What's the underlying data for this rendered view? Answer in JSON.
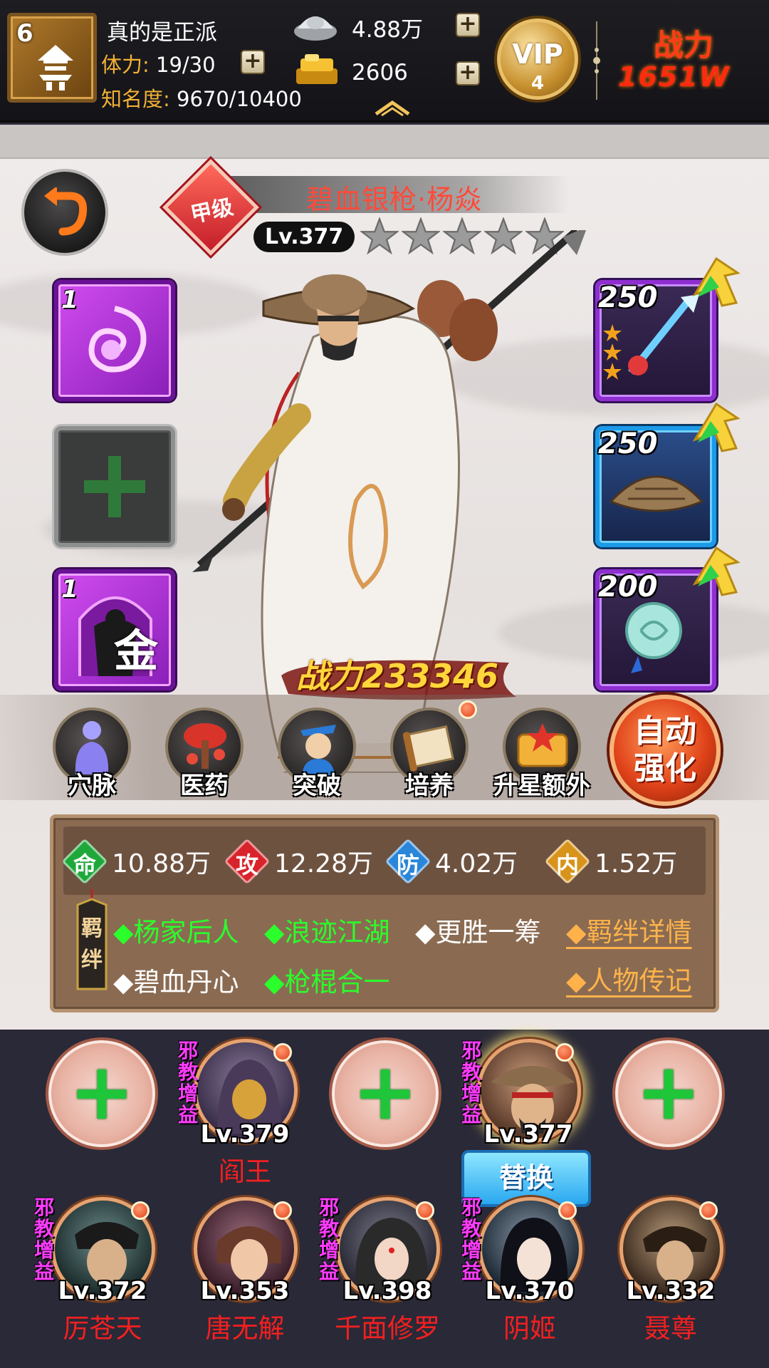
{
  "top": {
    "player_level": "6",
    "player_name": "真的是正派",
    "stamina_label": "体力:",
    "stamina_value": "19/30",
    "fame_label": "知名度:",
    "fame_value": "9670/10400",
    "silver": "4.88万",
    "gold": "2606",
    "vip_label": "VIP",
    "vip_level": "4",
    "power_label": "战力",
    "power_value": "1651W"
  },
  "hero": {
    "grade": "甲级",
    "name": "碧血银枪·杨焱",
    "level": "Lv.377",
    "stars": 5,
    "combat_power": "战力233346",
    "skill_slots": [
      {
        "count": "1",
        "icon": "purple-swirl-skill-icon"
      },
      {
        "count": "",
        "icon": "add-skill-icon"
      },
      {
        "count": "1",
        "icon": "purple-gold-skill-icon",
        "glyph": "金"
      }
    ],
    "equip_slots": [
      {
        "level": "250",
        "icon": "spear-weapon-icon"
      },
      {
        "level": "250",
        "icon": "straw-hat-armor-icon"
      },
      {
        "level": "200",
        "icon": "jade-pendant-icon"
      }
    ]
  },
  "functions": [
    {
      "label": "穴脉",
      "icon": "meridian-icon",
      "dot": false
    },
    {
      "label": "医药",
      "icon": "medicine-icon",
      "dot": false
    },
    {
      "label": "突破",
      "icon": "breakthrough-icon",
      "dot": false
    },
    {
      "label": "培养",
      "icon": "train-scroll-icon",
      "dot": true
    },
    {
      "label": "升星额外",
      "icon": "star-up-icon",
      "dot": false
    }
  ],
  "auto_strengthen": "自动\n强化",
  "stats": [
    {
      "char": "命",
      "value": "10.88万",
      "color": "#1fa83a"
    },
    {
      "char": "攻",
      "value": "12.28万",
      "color": "#d8232a"
    },
    {
      "char": "防",
      "value": "4.02万",
      "color": "#2a86d8"
    },
    {
      "char": "内",
      "value": "1.52万",
      "color": "#d8931a"
    }
  ],
  "bond_tag": "羁绊",
  "bonds": [
    {
      "text": "◆杨家后人",
      "active": true
    },
    {
      "text": "◆浪迹江湖",
      "active": true
    },
    {
      "text": "◆更胜一筹",
      "active": false
    },
    {
      "text": "◆碧血丹心",
      "active": false
    },
    {
      "text": "◆枪棍合一",
      "active": true
    }
  ],
  "links": {
    "bond_detail": "◆羁绊详情",
    "biography": "◆人物传记"
  },
  "lineup": {
    "tag": "邪教增益",
    "front": [
      {
        "type": "add"
      },
      {
        "type": "hero",
        "level": "Lv.379",
        "name": "阎王"
      },
      {
        "type": "add"
      },
      {
        "type": "hero",
        "level": "Lv.377",
        "name": ""
      },
      {
        "type": "add"
      }
    ],
    "replace_label": "替换",
    "back": [
      {
        "level": "Lv.372",
        "name": "厉苍天"
      },
      {
        "level": "Lv.353",
        "name": "唐无解"
      },
      {
        "level": "Lv.398",
        "name": "千面修罗"
      },
      {
        "level": "Lv.370",
        "name": "阴姬"
      },
      {
        "level": "Lv.332",
        "name": "聂尊"
      }
    ]
  }
}
